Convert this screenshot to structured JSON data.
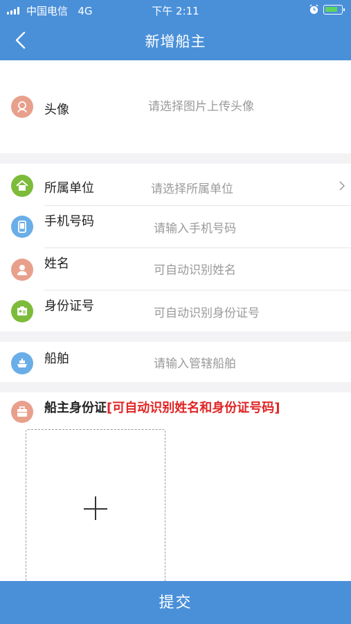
{
  "status_bar": {
    "carrier": "中国电信",
    "network": "4G",
    "time": "下午 2:11"
  },
  "nav": {
    "title": "新增船主",
    "back_icon": "chevron-left-icon"
  },
  "avatar_row": {
    "label": "头像",
    "placeholder": "请选择图片上传头像",
    "icon": "avatar-icon",
    "icon_color": "#e8a08c"
  },
  "info_rows": [
    {
      "label": "所属单位",
      "placeholder": "请选择所属单位",
      "icon": "home-icon",
      "icon_color": "#7dbb3a"
    },
    {
      "label": "手机号码",
      "placeholder": "请输入手机号码",
      "icon": "phone-icon",
      "icon_color": "#6aaee8"
    },
    {
      "label": "姓名",
      "placeholder": "可自动识别姓名",
      "icon": "person-icon",
      "icon_color": "#e8a08c"
    },
    {
      "label": "身份证号",
      "placeholder": "可自动识别身份证号",
      "icon": "id-card-icon",
      "icon_color": "#7dbb3a"
    }
  ],
  "ship_row": {
    "label": "船舶",
    "placeholder": "请输入管辖船舶",
    "icon": "ship-icon",
    "icon_color": "#6aaee8"
  },
  "id_section": {
    "title": "船主身份证",
    "hint": "[可自动识别姓名和身份证号码]",
    "bracket_close": "]",
    "icon": "briefcase-icon",
    "icon_color": "#e8a08c"
  },
  "submit_label": "提交",
  "colors": {
    "primary": "#4a90d9",
    "hint_red": "#e02424"
  }
}
